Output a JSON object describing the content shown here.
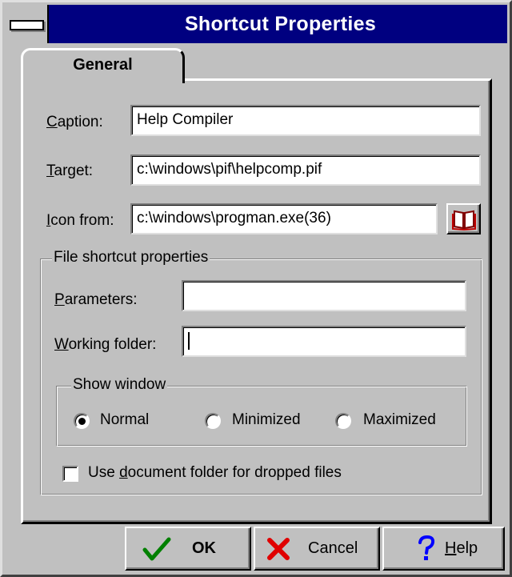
{
  "window": {
    "title": "Shortcut Properties"
  },
  "tabs": [
    {
      "label": "General",
      "active": true
    }
  ],
  "fields": {
    "caption": {
      "label_mnemonic": "C",
      "label_rest": "aption:",
      "value": "Help Compiler"
    },
    "target": {
      "label_mnemonic": "T",
      "label_rest": "arget:",
      "value": "c:\\windows\\pif\\helpcomp.pif"
    },
    "icon_from": {
      "label_mnemonic": "I",
      "label_rest": "con from:",
      "value": "c:\\windows\\progman.exe(36)",
      "browse_icon": "book-icon"
    }
  },
  "file_group": {
    "title": "File shortcut properties",
    "parameters": {
      "label_mnemonic": "P",
      "label_rest": "arameters:",
      "value": ""
    },
    "working_folder": {
      "label_mnemonic": "W",
      "label_rest": "orking folder:",
      "value": ""
    },
    "show_window": {
      "title": "Show window",
      "options": [
        {
          "label": "Normal",
          "selected": true
        },
        {
          "label": "Minimized",
          "selected": false
        },
        {
          "label": "Maximized",
          "selected": false
        }
      ]
    },
    "use_doc_folder": {
      "label_before": "Use ",
      "label_mnemonic": "d",
      "label_after": "ocument folder for dropped files",
      "checked": false
    }
  },
  "buttons": {
    "ok": {
      "label": "OK",
      "icon": "checkmark-icon",
      "icon_color": "#008000"
    },
    "cancel": {
      "label": "Cancel",
      "icon": "x-icon",
      "icon_color": "#ff0000"
    },
    "help": {
      "label_mnemonic": "H",
      "label_rest": "elp",
      "icon": "question-icon",
      "icon_color": "#0000ff"
    }
  }
}
